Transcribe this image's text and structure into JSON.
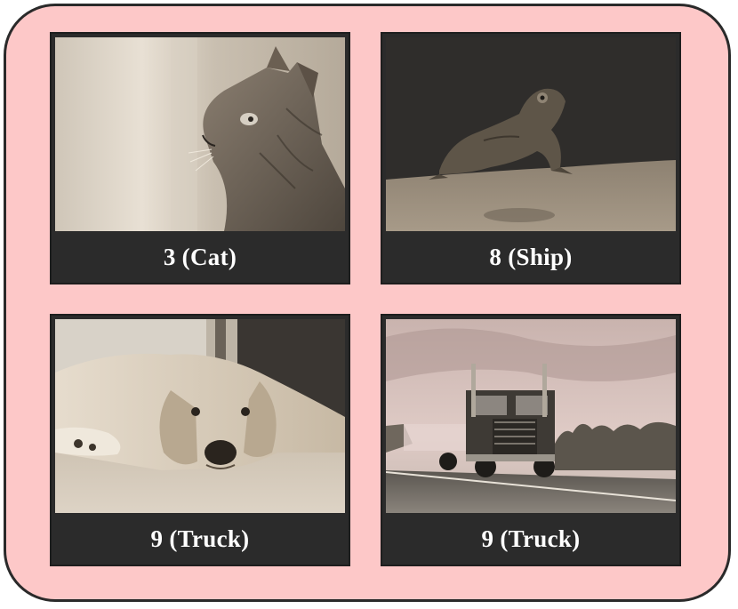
{
  "panels": [
    {
      "image": "cat-photo",
      "label": "3 (Cat)"
    },
    {
      "image": "frog-photo",
      "label": "8 (Ship)"
    },
    {
      "image": "dog-photo",
      "label": "9 (Truck)"
    },
    {
      "image": "truck-photo",
      "label": "9 (Truck)"
    }
  ],
  "colors": {
    "frame_background": "#fdc8c8",
    "frame_border": "#2a2a2a",
    "caption_background": "#2b2b2b",
    "caption_text": "#ffffff"
  }
}
